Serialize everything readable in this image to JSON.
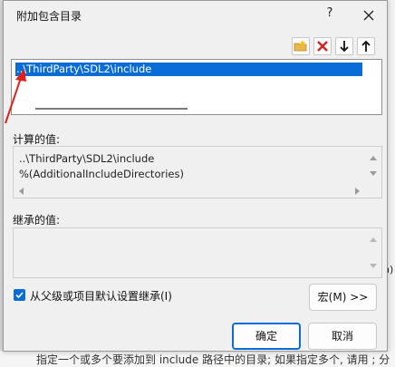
{
  "dialog": {
    "title": "附加包含目录",
    "help_label": "?",
    "colors": {
      "accent": "#0a6cd6",
      "annotation": "#e0201a"
    }
  },
  "toolbar": {
    "icons": [
      "new-folder-icon",
      "delete-icon",
      "move-down-icon",
      "move-up-icon"
    ]
  },
  "list": {
    "items": [
      "..\\ThirdParty\\SDL2\\include"
    ]
  },
  "computed": {
    "label": "计算的值:",
    "lines": [
      "..\\ThirdParty\\SDL2\\include",
      "%(AdditionalIncludeDirectories)"
    ]
  },
  "inherited": {
    "label": "继承的值:"
  },
  "inherit_checkbox": {
    "label": "从父级或项目默认设置继承(I)",
    "checked": true
  },
  "buttons": {
    "macros": "宏(M) >>",
    "ok": "确定",
    "cancel": "取消"
  },
  "background": {
    "bottom_text": "指定一个或多个要添加到 include 路径中的目录; 如果指定多个, 请用 ; 分",
    "right_text": "n)"
  }
}
